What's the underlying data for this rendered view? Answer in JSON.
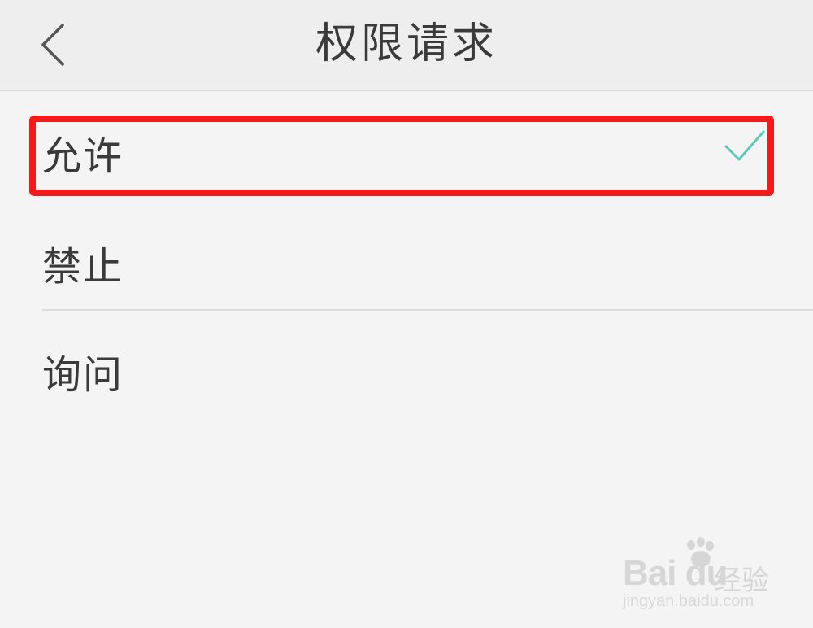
{
  "header": {
    "title": "权限请求",
    "back_icon": "chevron-left-icon"
  },
  "options": [
    {
      "label": "允许",
      "selected": true
    },
    {
      "label": "禁止",
      "selected": false
    },
    {
      "label": "询问",
      "selected": false
    }
  ],
  "colors": {
    "check": "#5cc9b8",
    "highlight": "#f21a1a",
    "background": "#f4f4f4",
    "header_bg": "#eeeeee"
  },
  "watermark": {
    "logo": "Bai du",
    "text": "经验",
    "url": "jingyan.baidu.com"
  }
}
